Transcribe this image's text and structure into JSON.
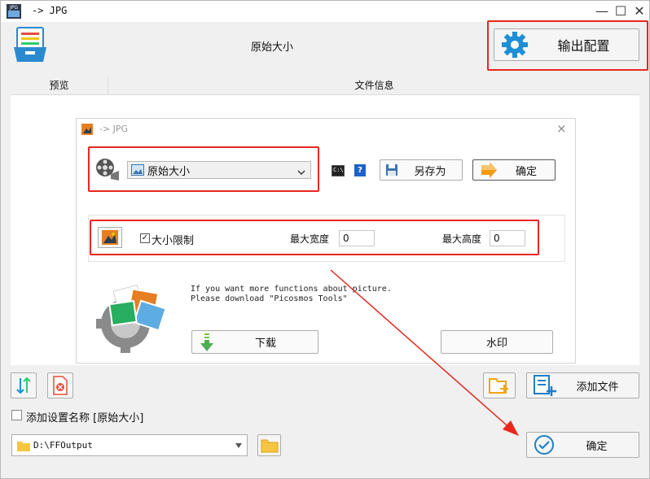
{
  "window": {
    "title": "-> JPG",
    "app_icon_text": "JPG",
    "minimize": "—",
    "maximize": "☐",
    "close": "✕"
  },
  "header": {
    "preset_name": "原始大小",
    "output_config_label": "输出配置"
  },
  "tabs": {
    "preview": "预览",
    "file_info": "文件信息"
  },
  "dialog": {
    "title": "-> JPG",
    "close": "×",
    "preset_select": {
      "value": "原始大小"
    },
    "cmd_icon_text": "C:\\",
    "help_label": "?",
    "save_as_label": "另存为",
    "ok_label": "确定",
    "size_limit_label": "大小限制",
    "size_limit_checked": true,
    "max_width_label": "最大宽度",
    "max_width_value": "0",
    "max_height_label": "最大高度",
    "max_height_value": "0",
    "promo_line1": "If you want more functions about picture.",
    "promo_line2": "Please download \"Picosmos Tools\"",
    "download_label": "下载",
    "watermark_label": "水印"
  },
  "bottom": {
    "add_file_label": "添加文件",
    "add_setting_name_label": "添加设置名称 [原始大小]",
    "output_path": "D:\\FFOutput",
    "confirm_label": "确定"
  },
  "colors": {
    "annotation_red": "#e8271f",
    "accent_blue": "#1e8fd5"
  }
}
